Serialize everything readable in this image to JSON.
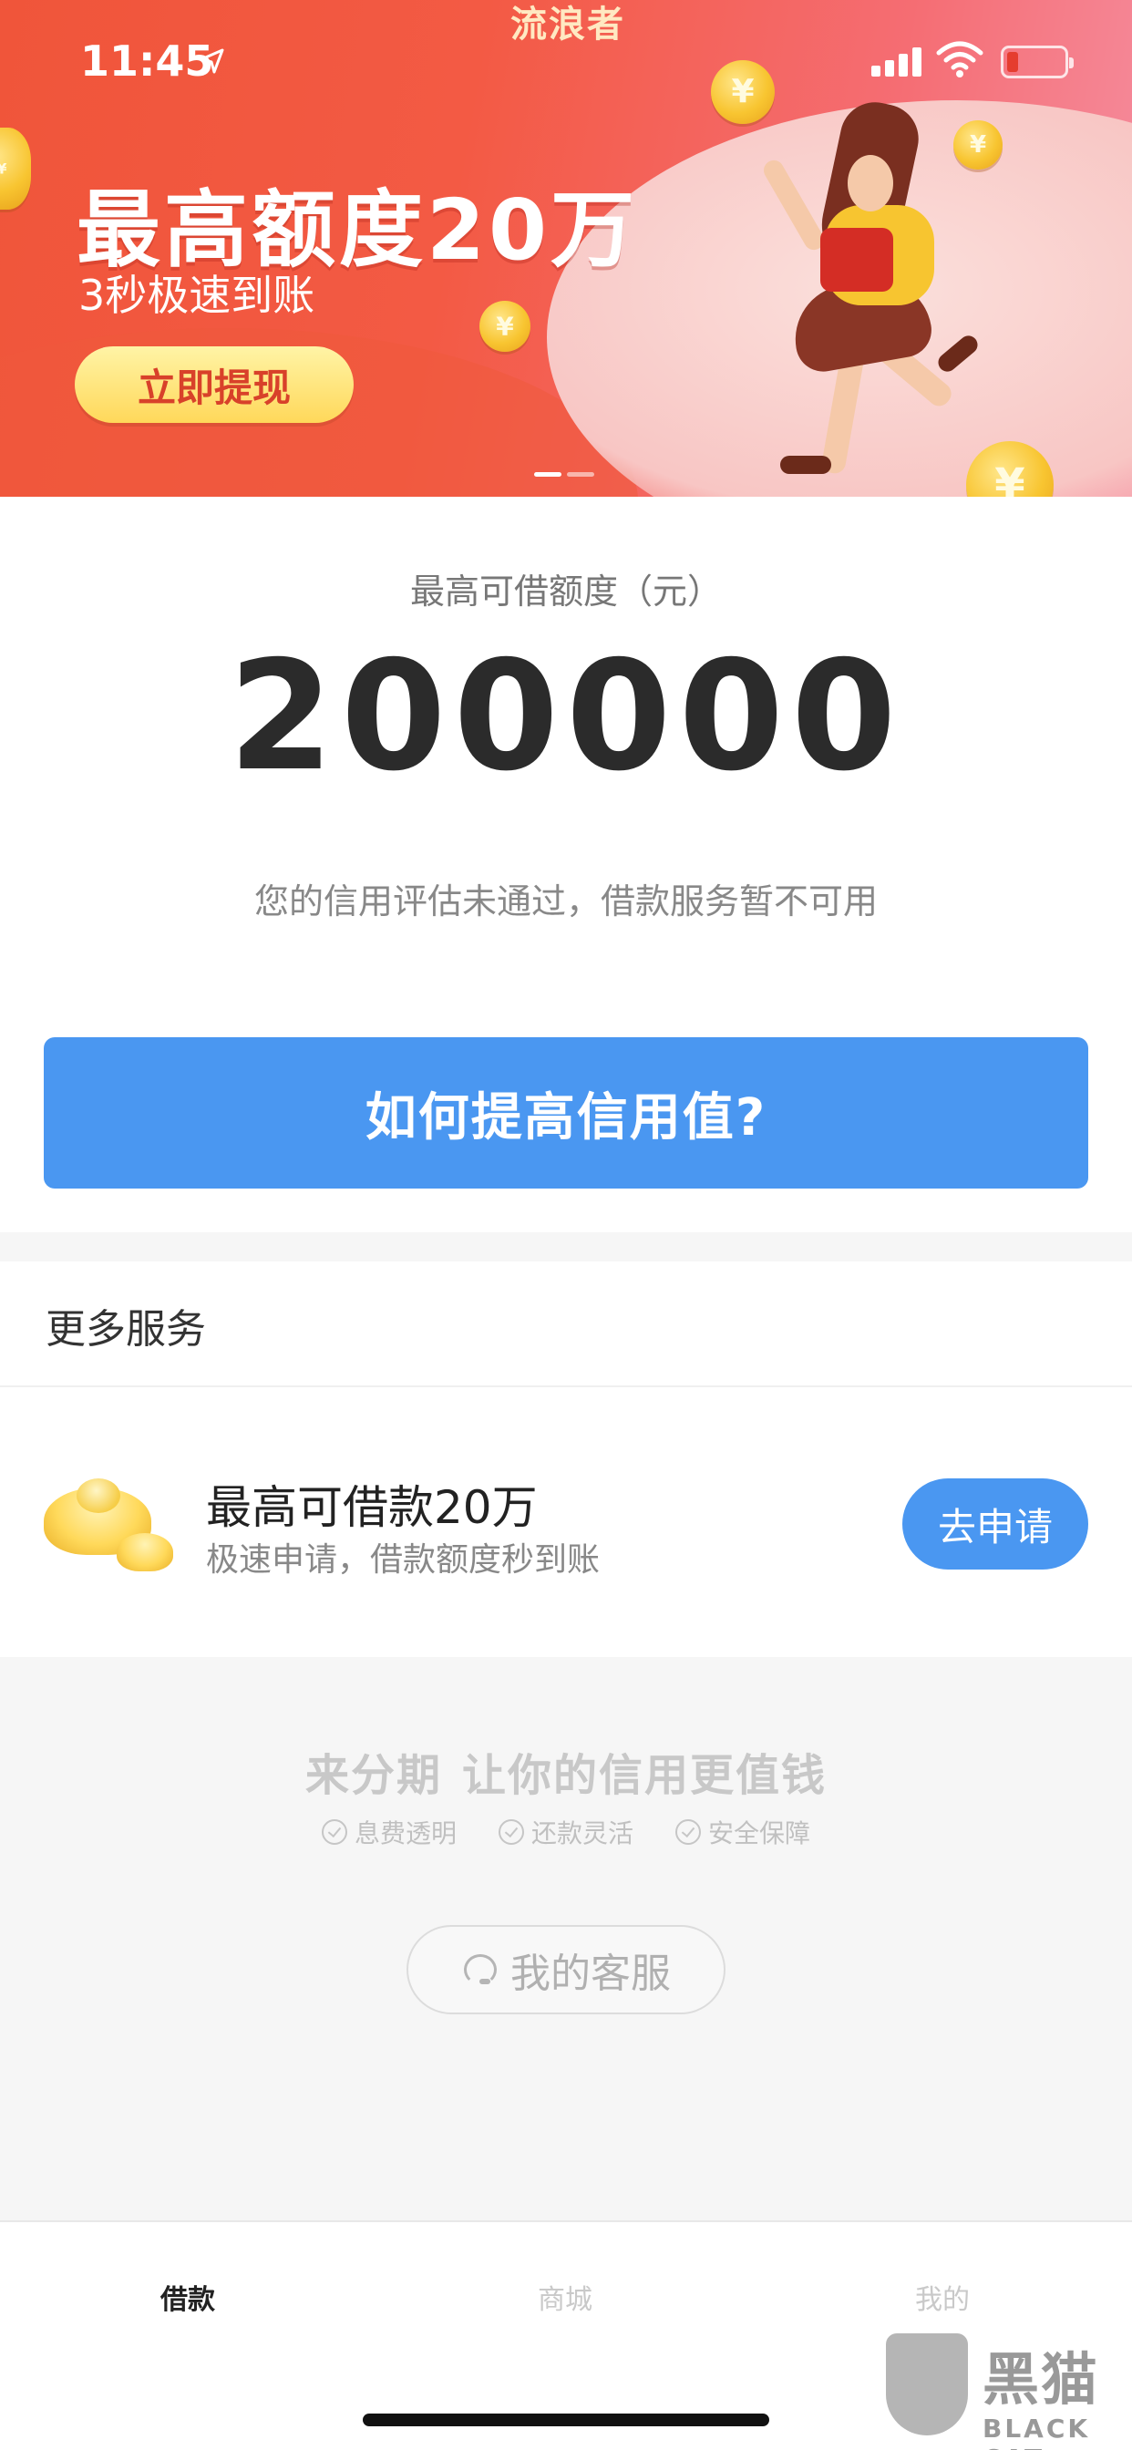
{
  "status_bar": {
    "time": "11:45"
  },
  "banner": {
    "brand_text": "流浪者",
    "headline": "最高额度20万",
    "subline": "3秒极速到账",
    "cta_label": "立即提现"
  },
  "credit": {
    "caption": "最高可借额度（元）",
    "amount": "200000",
    "notice": "您的信用评估未通过，借款服务暂不可用",
    "improve_label": "如何提高信用值?"
  },
  "more_services": {
    "title": "更多服务",
    "item": {
      "title": "最高可借款20万",
      "subtitle": "极速申请，借款额度秒到账",
      "apply_label": "去申请"
    }
  },
  "footer": {
    "slogan_brand": "来分期",
    "slogan_text": "让你的信用更值钱",
    "features": [
      "息费透明",
      "还款灵活",
      "安全保障"
    ],
    "support_label": "我的客服"
  },
  "tabs": [
    "借款",
    "商城",
    "我的"
  ],
  "watermark": {
    "cn": "黑猫",
    "en": "BLACK CAT"
  },
  "colors": {
    "primary_blue": "#4a97f1",
    "banner_red": "#f0553a"
  }
}
